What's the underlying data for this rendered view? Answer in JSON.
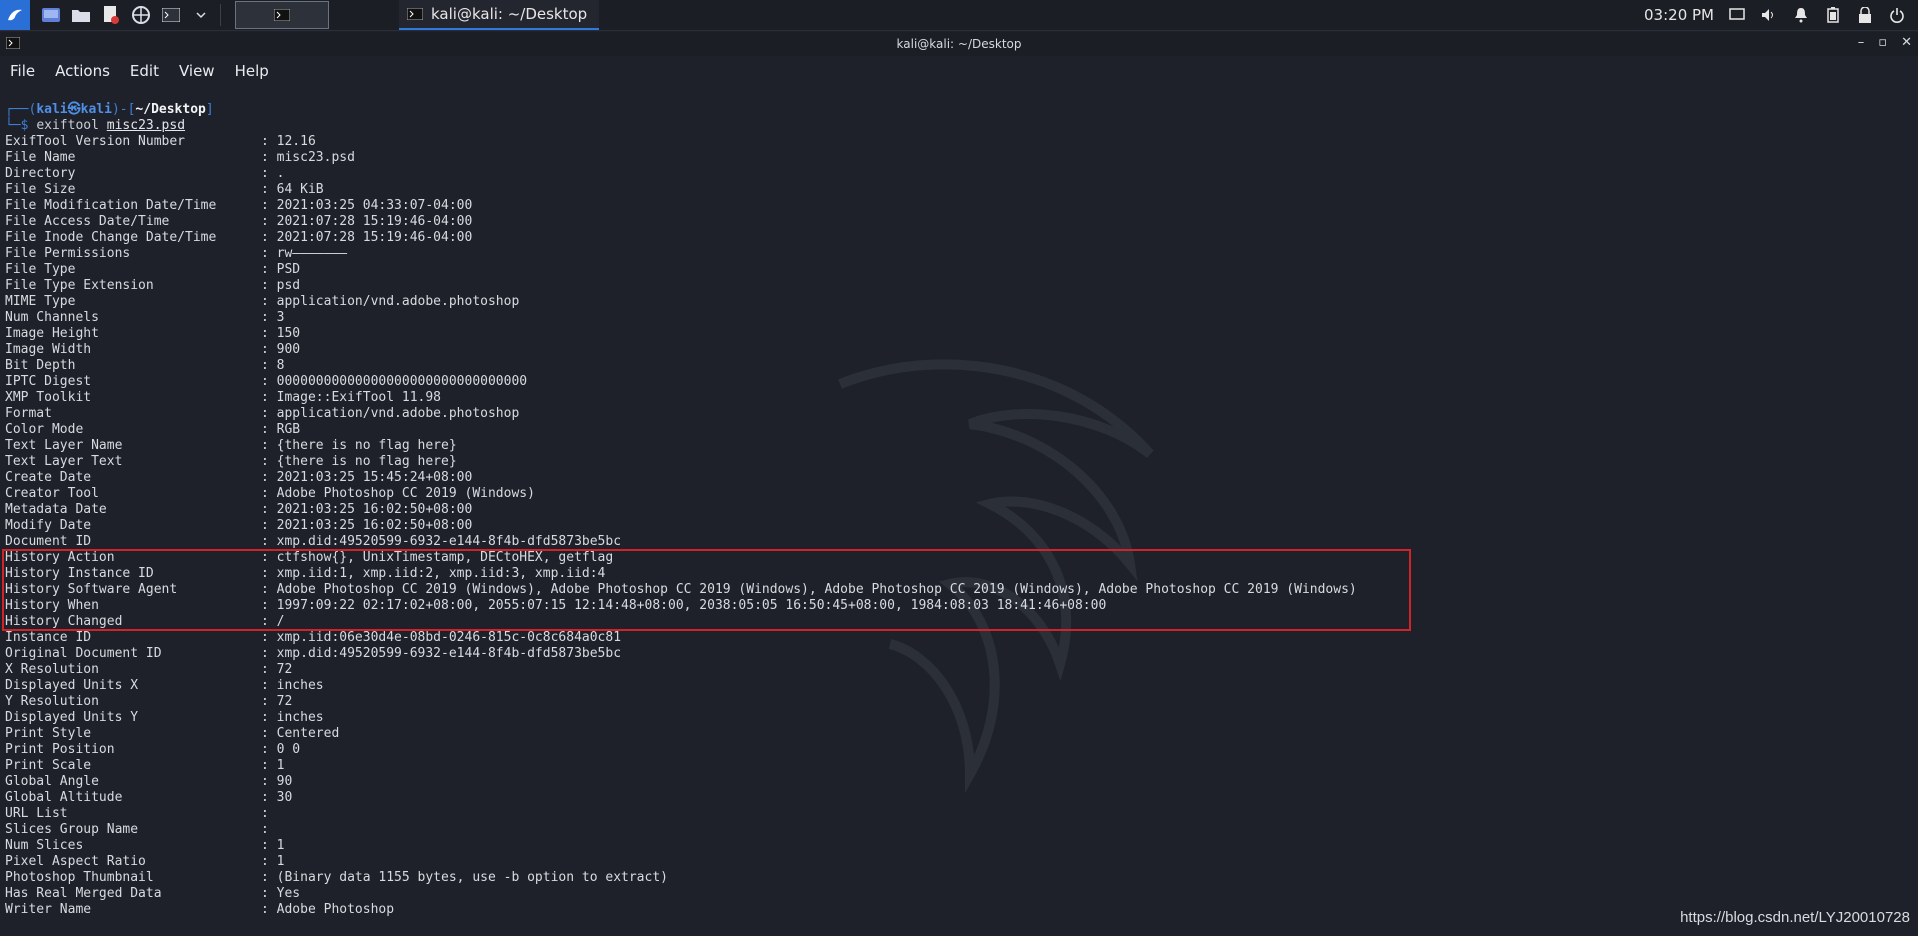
{
  "taskbar": {
    "task_title": "kali@kali: ~/Desktop",
    "clock": "03:20 PM"
  },
  "window": {
    "title": "kali@kali: ~/Desktop"
  },
  "menu": [
    "File",
    "Actions",
    "Edit",
    "View",
    "Help"
  ],
  "prompt": {
    "user": "kali㉿kali",
    "path": "~/Desktop",
    "command": "exiftool",
    "argument": "misc23.psd"
  },
  "rows": [
    {
      "k": "ExifTool Version Number",
      "v": ": 12.16"
    },
    {
      "k": "File Name",
      "v": ": misc23.psd"
    },
    {
      "k": "Directory",
      "v": ": ."
    },
    {
      "k": "File Size",
      "v": ": 64 KiB"
    },
    {
      "k": "File Modification Date/Time",
      "v": ": 2021:03:25 04:33:07-04:00"
    },
    {
      "k": "File Access Date/Time",
      "v": ": 2021:07:28 15:19:46-04:00"
    },
    {
      "k": "File Inode Change Date/Time",
      "v": ": 2021:07:28 15:19:46-04:00"
    },
    {
      "k": "File Permissions",
      "v": ": rw———————"
    },
    {
      "k": "File Type",
      "v": ": PSD"
    },
    {
      "k": "File Type Extension",
      "v": ": psd"
    },
    {
      "k": "MIME Type",
      "v": ": application/vnd.adobe.photoshop"
    },
    {
      "k": "Num Channels",
      "v": ": 3"
    },
    {
      "k": "Image Height",
      "v": ": 150"
    },
    {
      "k": "Image Width",
      "v": ": 900"
    },
    {
      "k": "Bit Depth",
      "v": ": 8"
    },
    {
      "k": "IPTC Digest",
      "v": ": 00000000000000000000000000000000"
    },
    {
      "k": "XMP Toolkit",
      "v": ": Image::ExifTool 11.98"
    },
    {
      "k": "Format",
      "v": ": application/vnd.adobe.photoshop"
    },
    {
      "k": "Color Mode",
      "v": ": RGB"
    },
    {
      "k": "Text Layer Name",
      "v": ": {there is no flag here}"
    },
    {
      "k": "Text Layer Text",
      "v": ": {there is no flag here}"
    },
    {
      "k": "Create Date",
      "v": ": 2021:03:25 15:45:24+08:00"
    },
    {
      "k": "Creator Tool",
      "v": ": Adobe Photoshop CC 2019 (Windows)"
    },
    {
      "k": "Metadata Date",
      "v": ": 2021:03:25 16:02:50+08:00"
    },
    {
      "k": "Modify Date",
      "v": ": 2021:03:25 16:02:50+08:00"
    },
    {
      "k": "Document ID",
      "v": ": xmp.did:49520599-6932-e144-8f4b-dfd5873be5bc"
    },
    {
      "k": "History Action",
      "v": ": ctfshow{}, UnixTimestamp, DECtoHEX, getflag"
    },
    {
      "k": "History Instance ID",
      "v": ": xmp.iid:1, xmp.iid:2, xmp.iid:3, xmp.iid:4"
    },
    {
      "k": "History Software Agent",
      "v": ": Adobe Photoshop CC 2019 (Windows), Adobe Photoshop CC 2019 (Windows), Adobe Photoshop CC 2019 (Windows), Adobe Photoshop CC 2019 (Windows)"
    },
    {
      "k": "History When",
      "v": ": 1997:09:22 02:17:02+08:00, 2055:07:15 12:14:48+08:00, 2038:05:05 16:50:45+08:00, 1984:08:03 18:41:46+08:00"
    },
    {
      "k": "History Changed",
      "v": ": /"
    },
    {
      "k": "Instance ID",
      "v": ": xmp.iid:06e30d4e-08bd-0246-815c-0c8c684a0c81"
    },
    {
      "k": "Original Document ID",
      "v": ": xmp.did:49520599-6932-e144-8f4b-dfd5873be5bc"
    },
    {
      "k": "X Resolution",
      "v": ": 72"
    },
    {
      "k": "Displayed Units X",
      "v": ": inches"
    },
    {
      "k": "Y Resolution",
      "v": ": 72"
    },
    {
      "k": "Displayed Units Y",
      "v": ": inches"
    },
    {
      "k": "Print Style",
      "v": ": Centered"
    },
    {
      "k": "Print Position",
      "v": ": 0 0"
    },
    {
      "k": "Print Scale",
      "v": ": 1"
    },
    {
      "k": "Global Angle",
      "v": ": 90"
    },
    {
      "k": "Global Altitude",
      "v": ": 30"
    },
    {
      "k": "URL List",
      "v": ":"
    },
    {
      "k": "Slices Group Name",
      "v": ":"
    },
    {
      "k": "Num Slices",
      "v": ": 1"
    },
    {
      "k": "Pixel Aspect Ratio",
      "v": ": 1"
    },
    {
      "k": "Photoshop Thumbnail",
      "v": ": (Binary data 1155 bytes, use -b option to extract)"
    },
    {
      "k": "Has Real Merged Data",
      "v": ": Yes"
    },
    {
      "k": "Writer Name",
      "v": ": Adobe Photoshop"
    }
  ],
  "watermark": "https://blog.csdn.net/LYJ20010728"
}
